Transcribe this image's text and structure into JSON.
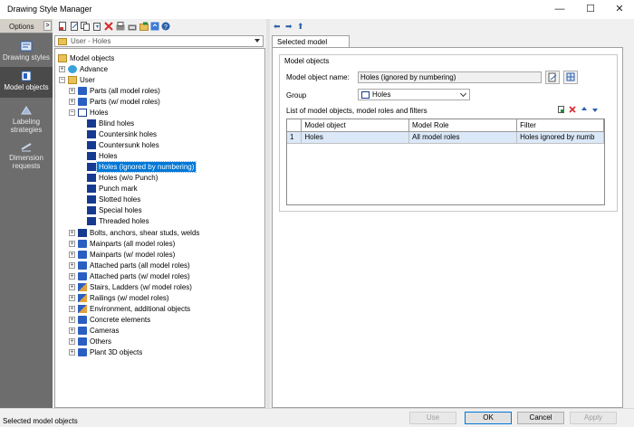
{
  "window": {
    "title": "Drawing Style Manager",
    "minimize_glyph": "—",
    "maximize_glyph": "☐",
    "close_glyph": "✕"
  },
  "sidebar": {
    "header_label": "Options",
    "collapse_glyph": ">",
    "items": [
      {
        "label": "Drawing styles",
        "icon": "drawing-styles-icon",
        "active": false
      },
      {
        "label": "Model objects",
        "icon": "model-objects-icon",
        "active": true
      },
      {
        "label": "Labeling strategies",
        "icon": "labeling-icon",
        "active": false
      },
      {
        "label": "Dimension requests",
        "icon": "dimension-icon",
        "active": false
      }
    ]
  },
  "filter_combo": {
    "value": "User - Holes"
  },
  "tree": {
    "root": "Model objects",
    "advance": "Advance",
    "user": "User",
    "parts_all": "Parts (all model roles)",
    "parts_w": "Parts (w/ model roles)",
    "holes": "Holes",
    "hole_children": [
      "Blind holes",
      "Countersink holes",
      "Countersunk holes",
      "Holes",
      "Holes (ignored by numbering)",
      "Holes (w/o Punch)",
      "Punch mark",
      "Slotted holes",
      "Special holes",
      "Threaded holes"
    ],
    "siblings": [
      "Bolts, anchors, shear studs, welds",
      "Mainparts (all model roles)",
      "Mainparts (w/ model roles)",
      "Attached parts (all model roles)",
      "Attached parts (w/ model roles)",
      "Stairs, Ladders (w/ model roles)",
      "Railings (w/ model roles)",
      "Environment, additional objects",
      "Concrete elements",
      "Cameras",
      "Others",
      "Plant 3D objects"
    ]
  },
  "right": {
    "nav": {
      "back": "⬅",
      "forward": "➡",
      "up": "⬆"
    },
    "tab_label": "Selected model objects",
    "group_title": "Model objects",
    "name_label": "Model object name:",
    "name_value": "Holes (ignored by numbering)",
    "group_label": "Group",
    "group_value": "Holes",
    "list_label": "List of model objects, model roles and filters",
    "grid": {
      "columns": [
        "",
        "Model object",
        "Model Role",
        "Filter"
      ],
      "rows": [
        {
          "num": "1",
          "object": "Holes",
          "role": "All model roles",
          "filter": "Holes ignored by numb"
        }
      ]
    }
  },
  "status": {
    "text": "Selected model objects"
  },
  "buttons": {
    "use": "Use",
    "ok": "OK",
    "cancel": "Cancel",
    "apply": "Apply"
  }
}
